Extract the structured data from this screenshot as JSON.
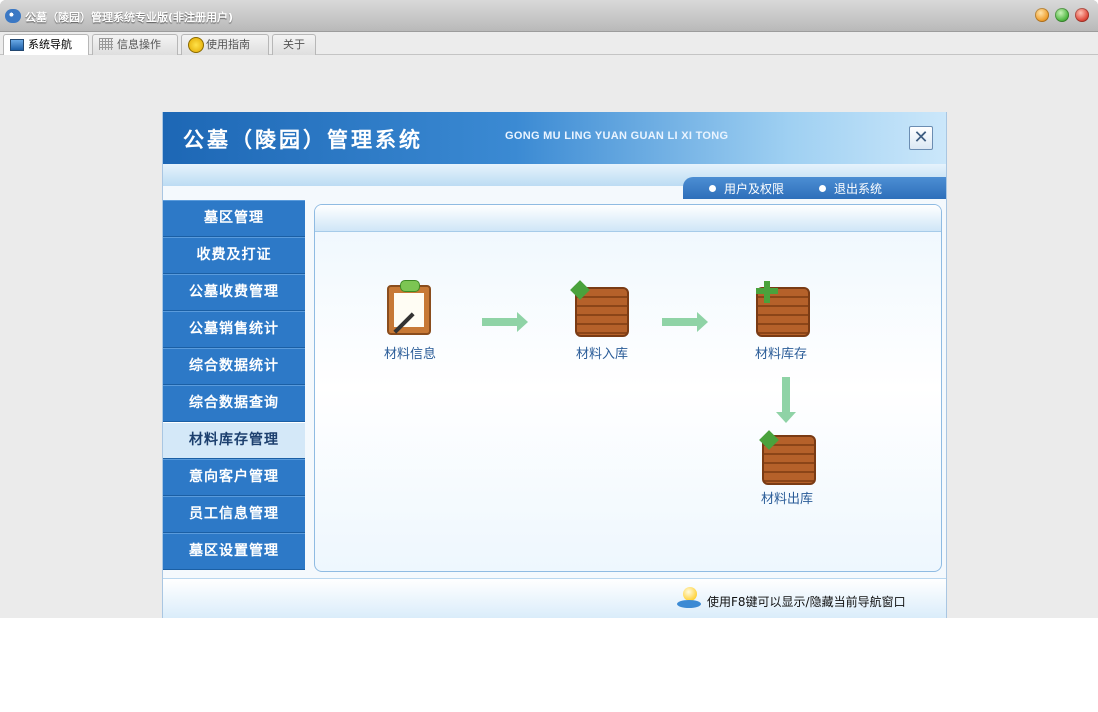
{
  "window": {
    "title": "公墓（陵园）管理系统专业版(非注册用户)",
    "controls": [
      "minimize-icon",
      "maximize-icon",
      "close-icon"
    ],
    "control_colors": [
      "#f0a030",
      "#52b944",
      "#e04a3c"
    ]
  },
  "tabs": [
    {
      "label": "系统导航",
      "icon": "monitor-icon",
      "active": true
    },
    {
      "label": "信息操作",
      "icon": "grid-icon",
      "active": false
    },
    {
      "label": "使用指南",
      "icon": "smiley-icon",
      "active": false
    },
    {
      "label": "关于",
      "icon": "",
      "active": false
    }
  ],
  "panel": {
    "title": "公墓（陵园）管理系统",
    "subtitle": "GONG MU LING YUAN GUAN LI XI TONG",
    "close_label": "✕",
    "menu": [
      "用户及权限",
      "退出系统"
    ]
  },
  "sidebar": {
    "items": [
      {
        "label": "墓区管理",
        "active": false
      },
      {
        "label": "收费及打证",
        "active": false
      },
      {
        "label": "公墓收费管理",
        "active": false
      },
      {
        "label": "公墓销售统计",
        "active": false
      },
      {
        "label": "综合数据统计",
        "active": false
      },
      {
        "label": "综合数据查询",
        "active": false
      },
      {
        "label": "材料库存管理",
        "active": true
      },
      {
        "label": "意向客户管理",
        "active": false
      },
      {
        "label": "员工信息管理",
        "active": false
      },
      {
        "label": "墓区设置管理",
        "active": false
      }
    ]
  },
  "flow": {
    "nodes": [
      {
        "label": "材料信息",
        "icon": "clipboard-icon"
      },
      {
        "label": "材料入库",
        "icon": "crate-in-icon"
      },
      {
        "label": "材料库存",
        "icon": "crate-add-icon"
      },
      {
        "label": "材料出库",
        "icon": "crate-out-icon"
      }
    ]
  },
  "status": {
    "text": "使用F8键可以显示/隐藏当前导航窗口",
    "icon": "lightbulb-icon"
  },
  "colors": {
    "accent": "#2d79c7",
    "arrow": "#8fd3a6",
    "crate": "#b5612a"
  }
}
